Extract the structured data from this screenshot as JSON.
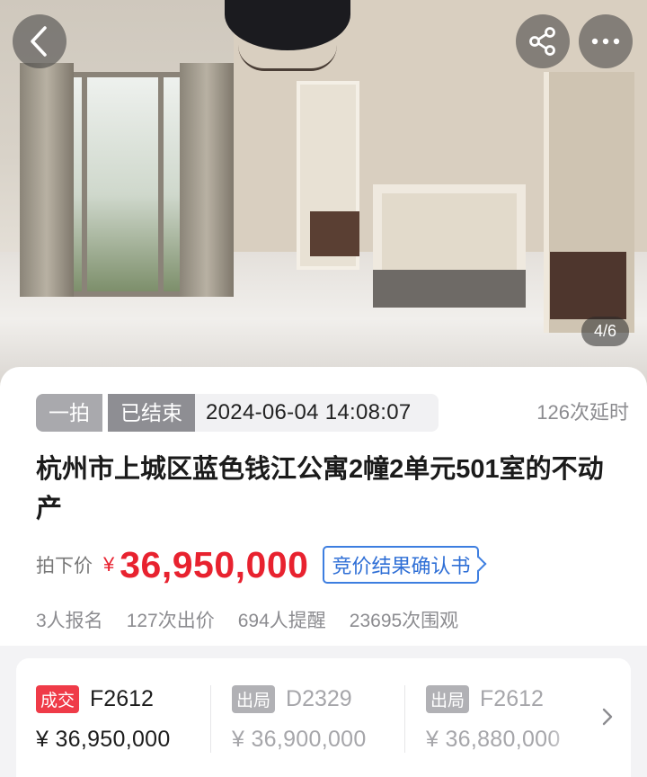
{
  "gallery": {
    "counter": "4/6"
  },
  "header": {
    "back_icon": "chevron-left-icon",
    "share_icon": "share-icon",
    "more_icon": "more-dots-icon"
  },
  "auction": {
    "round_tag": "一拍",
    "status_tag": "已结束",
    "end_time": "2024-06-04 14:08:07",
    "delay_count": "126次延时",
    "title": "杭州市上城区蓝色钱江公寓2幢2单元501室的不动产",
    "price_label": "拍下价",
    "currency": "¥",
    "price": "36,950,000",
    "confirm_link": "竞价结果确认书",
    "stats": {
      "signups": "3人报名",
      "bids": "127次出价",
      "reminders": "694人提醒",
      "views": "23695次围观"
    }
  },
  "bid_records": [
    {
      "status": "成交",
      "bidder": "F2612",
      "amount": "¥ 36,950,000"
    },
    {
      "status": "出局",
      "bidder": "D2329",
      "amount": "¥ 36,900,000"
    },
    {
      "status": "出局",
      "bidder": "F2612",
      "amount": "¥ 36,880,000"
    }
  ],
  "colors": {
    "accent_red": "#e8222f",
    "link_blue": "#2f6fd6",
    "deal_badge": "#ef3b48",
    "out_badge": "#b1b1b5"
  }
}
